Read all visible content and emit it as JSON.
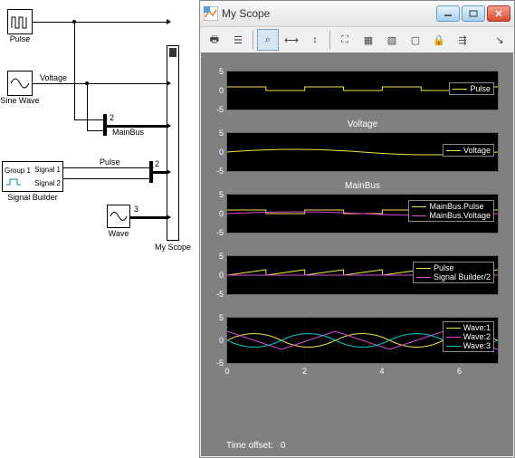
{
  "window": {
    "title": "My Scope",
    "time_offset_label": "Time offset:",
    "time_offset_value": "0"
  },
  "toolbar": {
    "print": "⎙",
    "params": "⚙",
    "zoom": "🔍",
    "zoomx": "⤢",
    "zoomy": "⤡",
    "autoscale": "◻",
    "save": "💾",
    "restore": "↺",
    "float": "▫",
    "lock": "🔒",
    "sig": "⇉",
    "chev": "▾"
  },
  "diagram": {
    "pulse": "Pulse",
    "sine": "Sine Wave",
    "voltage": "Voltage",
    "mainbus": "MainBus",
    "signal_builder": "Signal Builder",
    "group1": "Group 1",
    "signal1": "Signal 1",
    "signal2": "Signal 2",
    "pulse2": "Pulse",
    "wave": "Wave",
    "scope": "My Scope",
    "num2": "2",
    "num3": "3"
  },
  "plots": {
    "p1": {
      "title": "",
      "legend": [
        "Pulse"
      ],
      "yticks": [
        "5",
        "0",
        "-5"
      ]
    },
    "p2": {
      "title": "Voltage",
      "legend": [
        "Voltage"
      ],
      "yticks": [
        "5",
        "0",
        "-5"
      ]
    },
    "p3": {
      "title": "MainBus",
      "legend": [
        "MainBus.Pulse",
        "MainBus.Voltage"
      ],
      "yticks": [
        "5",
        "0",
        "-5"
      ]
    },
    "p4": {
      "title": "",
      "legend": [
        "Pulse",
        "Signal Builder/2"
      ],
      "yticks": [
        "5",
        "0",
        "-5"
      ]
    },
    "p5": {
      "title": "",
      "legend": [
        "Wave:1",
        "Wave:2",
        "Wave:3"
      ],
      "yticks": [
        "5",
        "0",
        "-5"
      ],
      "xticks": [
        "0",
        "2",
        "4",
        "6"
      ]
    }
  },
  "colors": {
    "yellow": "#f0e442",
    "magenta": "#d946d9",
    "cyan": "#00c8c8"
  },
  "chart_data": [
    {
      "type": "line",
      "title": "",
      "series": [
        {
          "name": "Pulse",
          "values": [
            1,
            1,
            0,
            0,
            1,
            1,
            0,
            0,
            1,
            1,
            0,
            0,
            1,
            1
          ]
        }
      ],
      "x": [
        0,
        1,
        1,
        2,
        2,
        3,
        3,
        4,
        4,
        5,
        5,
        6,
        6,
        7
      ],
      "ylim": [
        -5,
        5
      ],
      "xlim": [
        0,
        7
      ]
    },
    {
      "type": "line",
      "title": "Voltage",
      "series": [
        {
          "name": "Voltage",
          "values": [
            0,
            1,
            0,
            -1,
            0,
            1,
            0
          ]
        }
      ],
      "x": [
        0,
        1.75,
        3.5,
        5.25,
        7,
        8.75,
        10.5
      ],
      "ylim": [
        -5,
        5
      ],
      "xlim": [
        0,
        7
      ]
    },
    {
      "type": "line",
      "title": "MainBus",
      "series": [
        {
          "name": "MainBus.Pulse",
          "values": [
            1,
            1,
            0,
            0,
            1,
            1,
            0,
            0,
            1,
            1,
            0,
            0,
            1,
            1
          ]
        },
        {
          "name": "MainBus.Voltage",
          "values": [
            0,
            0.5,
            1,
            0.9,
            0.7,
            0.4,
            0,
            -0.4,
            -0.7,
            -0.9,
            -1,
            -0.9,
            -0.7,
            -0.4
          ]
        }
      ],
      "x": [
        0,
        0.5,
        1,
        1.5,
        2,
        2.5,
        3,
        3.5,
        4,
        4.5,
        5,
        5.5,
        6,
        6.5
      ],
      "ylim": [
        -5,
        5
      ],
      "xlim": [
        0,
        7
      ]
    },
    {
      "type": "line",
      "title": "",
      "series": [
        {
          "name": "Pulse",
          "values": [
            0,
            1,
            0,
            1,
            0,
            1,
            0,
            1,
            0,
            1,
            0,
            1,
            0,
            1
          ]
        },
        {
          "name": "Signal Builder/2",
          "values": [
            0,
            0,
            0,
            0,
            0,
            0,
            0,
            0,
            0,
            0,
            0,
            0,
            0,
            0
          ]
        }
      ],
      "x": [
        0,
        1,
        1,
        2,
        2,
        3,
        3,
        4,
        4,
        5,
        5,
        6,
        6,
        7
      ],
      "ylim": [
        -5,
        5
      ],
      "xlim": [
        0,
        7
      ]
    },
    {
      "type": "line",
      "title": "",
      "series": [
        {
          "name": "Wave:1",
          "values": [
            0,
            2,
            0,
            -2,
            0,
            2,
            0,
            -2,
            0,
            2,
            0
          ]
        },
        {
          "name": "Wave:2",
          "values": [
            2,
            0,
            -2,
            0,
            2,
            0,
            -2,
            0,
            2,
            0,
            -2
          ]
        },
        {
          "name": "Wave:3",
          "values": [
            0,
            -2,
            0,
            2,
            0,
            -2,
            0,
            2,
            0,
            -2,
            0
          ]
        }
      ],
      "x": [
        0,
        0.7,
        1.4,
        2.1,
        2.8,
        3.5,
        4.2,
        4.9,
        5.6,
        6.3,
        7
      ],
      "ylim": [
        -5,
        5
      ],
      "xlim": [
        0,
        7
      ]
    }
  ]
}
